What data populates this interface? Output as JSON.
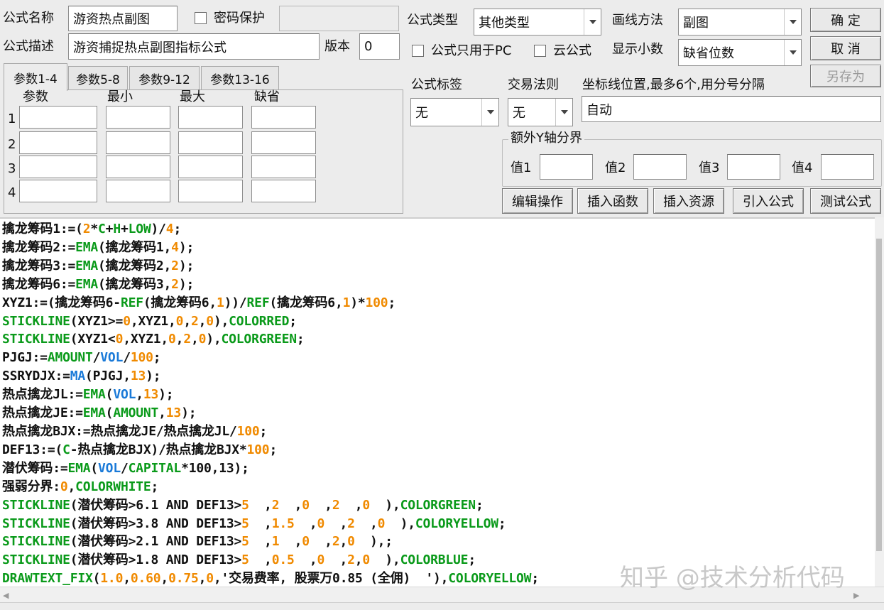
{
  "header": {
    "name_label": "公式名称",
    "name_value": "游资热点副图",
    "password_label": "密码保护",
    "password_value": "",
    "desc_label": "公式描述",
    "desc_value": "游资捕捉热点副图指标公式",
    "version_label": "版本",
    "version_value": "0",
    "type_label": "公式类型",
    "type_value": "其他类型",
    "draw_label": "画线方法",
    "draw_value": "副图",
    "pc_only_label": "公式只用于PC",
    "cloud_label": "云公式",
    "decimals_label": "显示小数",
    "decimals_value": "缺省位数"
  },
  "buttons": {
    "ok": "确  定",
    "cancel": "取  消",
    "save_as": "另存为",
    "edit_ops": "编辑操作",
    "insert_func": "插入函数",
    "insert_res": "插入资源",
    "import_formula": "引入公式",
    "test_formula": "测试公式"
  },
  "tabs": [
    "参数1-4",
    "参数5-8",
    "参数9-12",
    "参数13-16"
  ],
  "params": {
    "col_headers": [
      "参数",
      "最小",
      "最大",
      "缺省"
    ],
    "rows": [
      "1",
      "2",
      "3",
      "4"
    ]
  },
  "right_panel": {
    "tag_label": "公式标签",
    "tag_value": "无",
    "rule_label": "交易法则",
    "rule_value": "无",
    "coord_label": "坐标线位置,最多6个,用分号分隔",
    "coord_value": "自动",
    "extra_y_label": "额外Y轴分界",
    "values": [
      "值1",
      "值2",
      "值3",
      "值4"
    ]
  },
  "code_lines": [
    [
      [
        "擒龙筹码1:=(",
        "k"
      ],
      [
        "2",
        "o"
      ],
      [
        "*",
        "k"
      ],
      [
        "C",
        "g"
      ],
      [
        "+",
        "k"
      ],
      [
        "H",
        "g"
      ],
      [
        "+",
        "k"
      ],
      [
        "LOW",
        "g"
      ],
      [
        ")/",
        "k"
      ],
      [
        "4",
        "o"
      ],
      [
        ";",
        "k"
      ]
    ],
    [
      [
        "擒龙筹码2:=",
        "k"
      ],
      [
        "EMA",
        "g"
      ],
      [
        "(擒龙筹码1,",
        "k"
      ],
      [
        "4",
        "o"
      ],
      [
        ");",
        "k"
      ]
    ],
    [
      [
        "擒龙筹码3:=",
        "k"
      ],
      [
        "EMA",
        "g"
      ],
      [
        "(擒龙筹码2,",
        "k"
      ],
      [
        "2",
        "o"
      ],
      [
        ");",
        "k"
      ]
    ],
    [
      [
        "擒龙筹码6:=",
        "k"
      ],
      [
        "EMA",
        "g"
      ],
      [
        "(擒龙筹码3,",
        "k"
      ],
      [
        "2",
        "o"
      ],
      [
        ");",
        "k"
      ]
    ],
    [
      [
        "XYZ1:=(擒龙筹码6-",
        "k"
      ],
      [
        "REF",
        "g"
      ],
      [
        "(擒龙筹码6,",
        "k"
      ],
      [
        "1",
        "o"
      ],
      [
        "))/",
        "k"
      ],
      [
        "REF",
        "g"
      ],
      [
        "(擒龙筹码6,",
        "k"
      ],
      [
        "1",
        "o"
      ],
      [
        ")*",
        "k"
      ],
      [
        "100",
        "o"
      ],
      [
        ";",
        "k"
      ]
    ],
    [
      [
        "STICKLINE",
        "g"
      ],
      [
        "(XYZ1>=",
        "k"
      ],
      [
        "0",
        "o"
      ],
      [
        ",XYZ1,",
        "k"
      ],
      [
        "0",
        "o"
      ],
      [
        ",",
        "k"
      ],
      [
        "2",
        "o"
      ],
      [
        ",",
        "k"
      ],
      [
        "0",
        "o"
      ],
      [
        "),",
        "k"
      ],
      [
        "COLORRED",
        "g"
      ],
      [
        ";",
        "k"
      ]
    ],
    [
      [
        "STICKLINE",
        "g"
      ],
      [
        "(XYZ1<",
        "k"
      ],
      [
        "0",
        "o"
      ],
      [
        ",XYZ1,",
        "k"
      ],
      [
        "0",
        "o"
      ],
      [
        ",",
        "k"
      ],
      [
        "2",
        "o"
      ],
      [
        ",",
        "k"
      ],
      [
        "0",
        "o"
      ],
      [
        "),",
        "k"
      ],
      [
        "COLORGREEN",
        "g"
      ],
      [
        ";",
        "k"
      ]
    ],
    [
      [
        "PJGJ:=",
        "k"
      ],
      [
        "AMOUNT",
        "g"
      ],
      [
        "/",
        "k"
      ],
      [
        "VOL",
        "b"
      ],
      [
        "/",
        "k"
      ],
      [
        "100",
        "o"
      ],
      [
        ";",
        "k"
      ]
    ],
    [
      [
        "SSRYDJX:=",
        "k"
      ],
      [
        "MA",
        "b"
      ],
      [
        "(PJGJ,",
        "k"
      ],
      [
        "13",
        "o"
      ],
      [
        ");",
        "k"
      ]
    ],
    [
      [
        "热点擒龙JL:=",
        "k"
      ],
      [
        "EMA",
        "g"
      ],
      [
        "(",
        "k"
      ],
      [
        "VOL",
        "b"
      ],
      [
        ",",
        "k"
      ],
      [
        "13",
        "o"
      ],
      [
        ");",
        "k"
      ]
    ],
    [
      [
        "热点擒龙JE:=",
        "k"
      ],
      [
        "EMA",
        "g"
      ],
      [
        "(",
        "k"
      ],
      [
        "AMOUNT",
        "g"
      ],
      [
        ",",
        "k"
      ],
      [
        "13",
        "o"
      ],
      [
        ");",
        "k"
      ]
    ],
    [
      [
        "热点擒龙BJX:=热点擒龙JE/热点擒龙JL/",
        "k"
      ],
      [
        "100",
        "o"
      ],
      [
        ";",
        "k"
      ]
    ],
    [
      [
        "DEF13:=(",
        "k"
      ],
      [
        "C",
        "g"
      ],
      [
        "-热点擒龙BJX)/热点擒龙BJX*",
        "k"
      ],
      [
        "100",
        "o"
      ],
      [
        ";",
        "k"
      ]
    ],
    [
      [
        "潜伏筹码:=",
        "k"
      ],
      [
        "EMA",
        "g"
      ],
      [
        "(",
        "k"
      ],
      [
        "VOL",
        "b"
      ],
      [
        "/",
        "k"
      ],
      [
        "CAPITAL",
        "g"
      ],
      [
        "*100,13);",
        "k"
      ]
    ],
    [
      [
        "强弱分界:",
        "k"
      ],
      [
        "0",
        "o"
      ],
      [
        ",",
        "k"
      ],
      [
        "COLORWHITE",
        "g"
      ],
      [
        ";",
        "k"
      ]
    ],
    [
      [
        "STICKLINE",
        "g"
      ],
      [
        "(潜伏筹码>6.1 AND DEF13>",
        "k"
      ],
      [
        "5",
        "o"
      ],
      [
        "  ,",
        "k"
      ],
      [
        "2",
        "o"
      ],
      [
        "  ,",
        "k"
      ],
      [
        "0",
        "o"
      ],
      [
        "  ,",
        "k"
      ],
      [
        "2",
        "o"
      ],
      [
        "  ,",
        "k"
      ],
      [
        "0",
        "o"
      ],
      [
        "  ),",
        "k"
      ],
      [
        "COLORGREEN",
        "g"
      ],
      [
        ";",
        "k"
      ]
    ],
    [
      [
        "STICKLINE",
        "g"
      ],
      [
        "(潜伏筹码>3.8 AND DEF13>",
        "k"
      ],
      [
        "5",
        "o"
      ],
      [
        "  ,",
        "k"
      ],
      [
        "1.5",
        "o"
      ],
      [
        "  ,",
        "k"
      ],
      [
        "0",
        "o"
      ],
      [
        "  ,",
        "k"
      ],
      [
        "2",
        "o"
      ],
      [
        "  ,",
        "k"
      ],
      [
        "0",
        "o"
      ],
      [
        "  ),",
        "k"
      ],
      [
        "COLORYELLOW",
        "g"
      ],
      [
        ";",
        "k"
      ]
    ],
    [
      [
        "STICKLINE",
        "g"
      ],
      [
        "(潜伏筹码>2.1 AND DEF13>",
        "k"
      ],
      [
        "5",
        "o"
      ],
      [
        "  ,",
        "k"
      ],
      [
        "1",
        "o"
      ],
      [
        "  ,",
        "k"
      ],
      [
        "0",
        "o"
      ],
      [
        "  ,",
        "k"
      ],
      [
        "2",
        "o"
      ],
      [
        ",",
        "k"
      ],
      [
        "0",
        "o"
      ],
      [
        "  ),;",
        "k"
      ]
    ],
    [
      [
        "STICKLINE",
        "g"
      ],
      [
        "(潜伏筹码>1.8 AND DEF13>",
        "k"
      ],
      [
        "5",
        "o"
      ],
      [
        "  ,",
        "k"
      ],
      [
        "0.5",
        "o"
      ],
      [
        "  ,",
        "k"
      ],
      [
        "0",
        "o"
      ],
      [
        "  ,",
        "k"
      ],
      [
        "2",
        "o"
      ],
      [
        ",",
        "k"
      ],
      [
        "0",
        "o"
      ],
      [
        "  ),",
        "k"
      ],
      [
        "COLORBLUE",
        "g"
      ],
      [
        ";",
        "k"
      ]
    ],
    [
      [
        "DRAWTEXT_FIX",
        "g"
      ],
      [
        "(",
        "k"
      ],
      [
        "1.0",
        "o"
      ],
      [
        ",",
        "k"
      ],
      [
        "0.60",
        "o"
      ],
      [
        ",",
        "k"
      ],
      [
        "0.75",
        "o"
      ],
      [
        ",",
        "k"
      ],
      [
        "0",
        "o"
      ],
      [
        ",'交易费率, 股票万0.85 (全佣)  '),",
        "k"
      ],
      [
        "COLORYELLOW",
        "g"
      ],
      [
        ";",
        "k"
      ]
    ]
  ],
  "watermark": "知乎 @技术分析代码"
}
